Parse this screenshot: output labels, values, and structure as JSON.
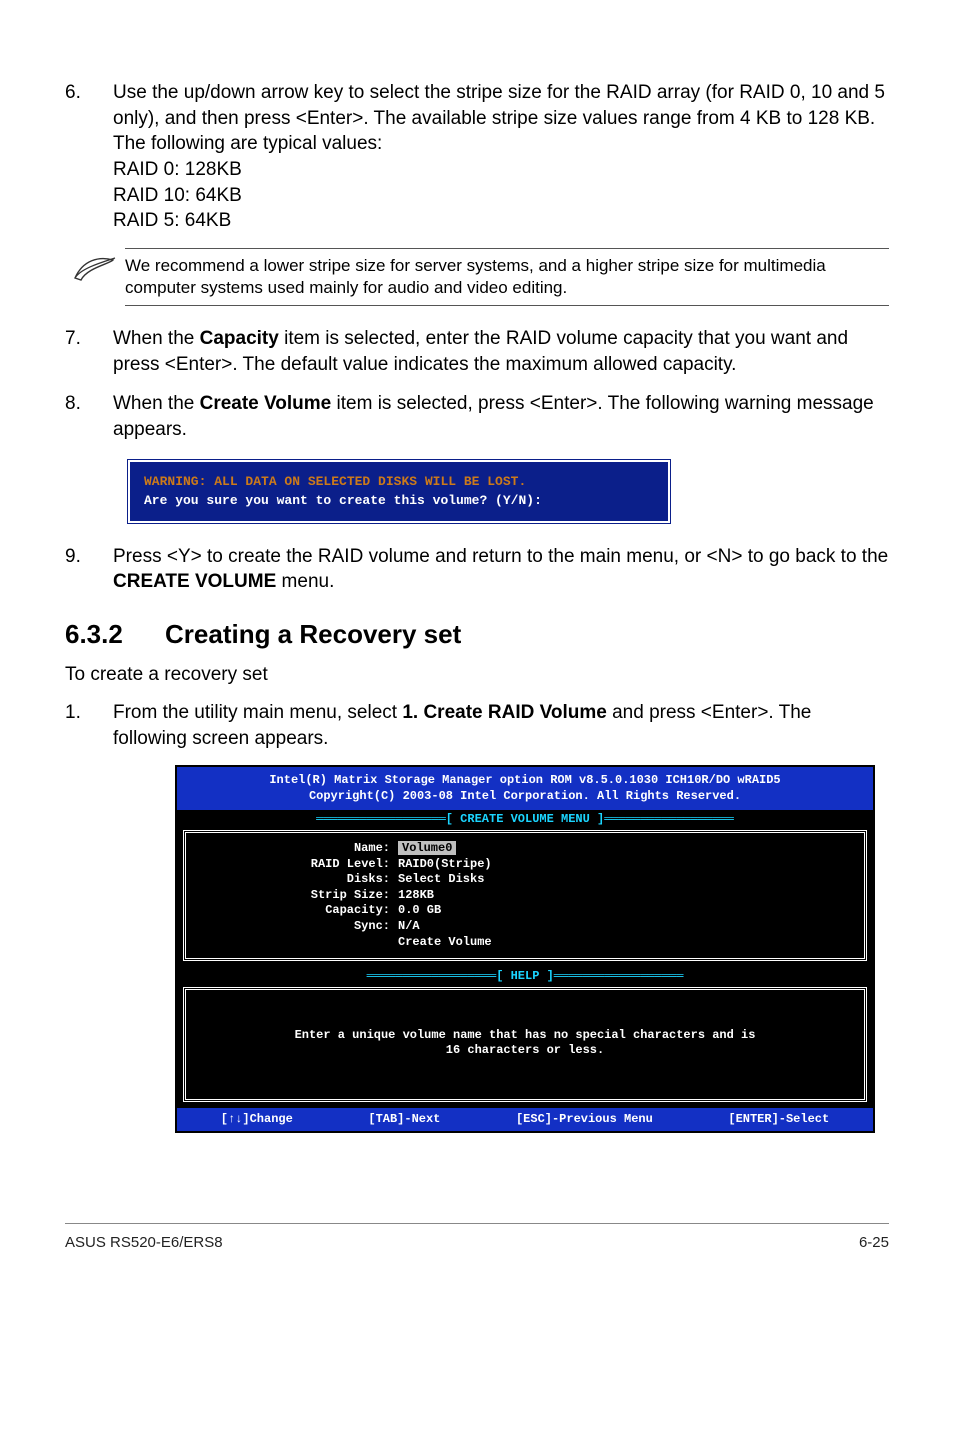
{
  "step6": {
    "num": "6.",
    "text": "Use the up/down arrow key to select the stripe size for the RAID array (for RAID 0, 10 and 5 only), and then press <Enter>. The available stripe size values range from 4 KB to 128 KB. The following are typical values:",
    "raid0": "RAID 0: 128KB",
    "raid10": "RAID 10: 64KB",
    "raid5": "RAID 5: 64KB"
  },
  "note": "We recommend a lower stripe size for server systems, and a higher stripe size for multimedia computer systems used mainly for audio and video editing.",
  "step7": {
    "num": "7.",
    "pre": "When the ",
    "bold": "Capacity",
    "post": " item is selected, enter the RAID volume capacity that you want and press <Enter>. The default value indicates the maximum allowed capacity."
  },
  "step8": {
    "num": "8.",
    "pre": "When the ",
    "bold": "Create Volume",
    "post": " item is selected, press <Enter>. The following warning message appears."
  },
  "dialog": {
    "warn": "WARNING: ALL DATA ON SELECTED DISKS WILL BE LOST.",
    "confirm": "Are you sure you want to create this volume? (Y/N):"
  },
  "step9": {
    "num": "9.",
    "pre": "Press <Y> to create the RAID volume and return to the main menu, or <N> to go back to the ",
    "bold": "CREATE VOLUME",
    "post": " menu."
  },
  "section": {
    "num": "6.3.2",
    "title": "Creating a Recovery set"
  },
  "recov_intro": "To create a recovery set",
  "step_r1": {
    "num": "1.",
    "pre": "From the utility main menu, select ",
    "bold": "1. Create RAID Volume",
    "post": " and press <Enter>. The following screen appears."
  },
  "bios": {
    "top1": "Intel(R) Matrix Storage Manager option ROM v8.5.0.1030 ICH10R/DO wRAID5",
    "top2": "Copyright(C) 2003-08 Intel Corporation.  All Rights Reserved.",
    "menu_title": "[ CREATE VOLUME MENU ]",
    "rows": {
      "name_label": "Name:",
      "name_val": "Volume0",
      "raid_label": "RAID Level:",
      "raid_val": "RAID0(Stripe)",
      "disks_label": "Disks:",
      "disks_val": "Select Disks",
      "strip_label": "Strip Size:",
      "strip_val": " 128KB",
      "cap_label": "Capacity:",
      "cap_val": "0.0   GB",
      "sync_label": "Sync:",
      "sync_val": "N/A",
      "create": "Create Volume"
    },
    "help_title": "[ HELP ]",
    "help1": "Enter a unique volume name that has no special characters and is",
    "help2": "16 characters or less.",
    "footer": {
      "change": "[↑↓]Change",
      "next": "[TAB]-Next",
      "prev": "[ESC]-Previous Menu",
      "select": "[ENTER]-Select"
    }
  },
  "footer": {
    "left": "ASUS RS520-E6/ERS8",
    "right": "6-25"
  }
}
